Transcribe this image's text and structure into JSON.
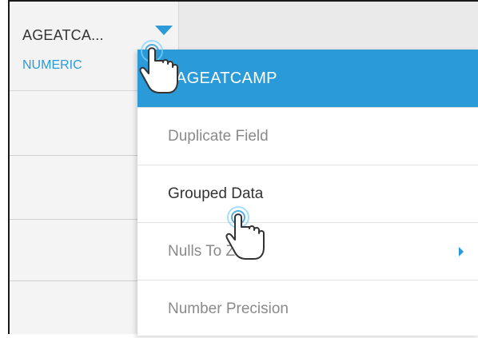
{
  "column": {
    "name": "AGEATCA...",
    "type": "NUMERIC"
  },
  "menu": {
    "title": "AGEATCAMP",
    "items": [
      {
        "label": "Duplicate Field"
      },
      {
        "label": "Grouped Data"
      },
      {
        "label": "Nulls To Zero",
        "has_submenu": true
      },
      {
        "label": "Number Precision"
      }
    ]
  },
  "colors": {
    "accent": "#2b9ad9",
    "menu_text_muted": "#8a8a8a",
    "menu_text_active": "#333333"
  },
  "icons": [
    "caret-down-icon",
    "submenu-arrow-icon",
    "hand-pointer-icon"
  ]
}
